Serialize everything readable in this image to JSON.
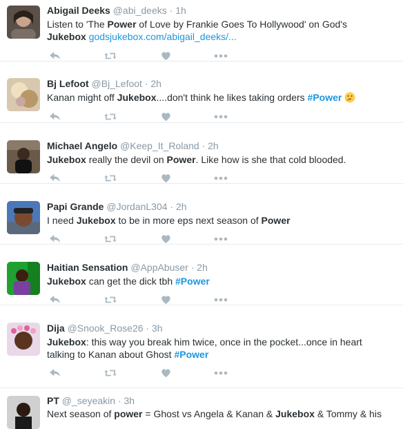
{
  "tweets": [
    {
      "name": "Abigail Deeks",
      "handle": "@abi_deeks",
      "sep": "·",
      "time": "1h",
      "text": {
        "p1": "Listen to 'The ",
        "k1": "Power",
        "p2": " of Love by Frankie Goes To Hollywood' on God's",
        "k2": "Jukebox",
        "p3": " ",
        "link": "godsjukebox.com/abigail_deeks/..."
      }
    },
    {
      "name": "Bj Lefoot",
      "handle": "@Bj_Lefoot",
      "sep": "·",
      "time": "2h",
      "text": {
        "p1": "Kanan might off ",
        "k1": "Jukebox",
        "p2": "....don't think he likes taking orders ",
        "tag": "#Power"
      }
    },
    {
      "name": "Michael Angelo",
      "handle": "@Keep_It_Roland",
      "sep": "·",
      "time": "2h",
      "text": {
        "k1": "Jukebox",
        "p1": " really the devil on ",
        "k2": "Power",
        "p2": ". Like how is she that cold blooded."
      }
    },
    {
      "name": "Papi Grande",
      "handle": "@JordanL304",
      "sep": "·",
      "time": "2h",
      "text": {
        "p1": "I need ",
        "k1": "Jukebox",
        "p2": " to be in more eps next season of ",
        "k2": "Power"
      }
    },
    {
      "name": "Haitian Sensation",
      "handle": "@AppAbuser",
      "sep": "·",
      "time": "2h",
      "text": {
        "k1": "Jukebox",
        "p1": " can get the dick tbh ",
        "tag": "#Power"
      }
    },
    {
      "name": "Dija",
      "handle": "@Snook_Rose26",
      "sep": "·",
      "time": "3h",
      "text": {
        "k1": "Jukebox",
        "p1": ": this way you break him twice, once in the pocket...once in heart",
        "p2": "talking to Kanan about Ghost ",
        "tag": "#Power"
      }
    },
    {
      "name": "PT",
      "handle": "@_seyeakin",
      "sep": "·",
      "time": "3h",
      "text": {
        "p1": "Next season of ",
        "k1": "power",
        "p2": " = Ghost vs Angela & Kanan & ",
        "k2": "Jukebox",
        "p3": " & Tommy & his"
      }
    }
  ],
  "icons": {
    "reply": "reply-icon",
    "retweet": "retweet-icon",
    "like": "heart-icon",
    "more": "more-icon",
    "emoji": "thinking-face-emoji"
  },
  "colors": {
    "text": "#292f33",
    "muted": "#8899a6",
    "link": "#1b95e0",
    "action_icon": "#aab8c2",
    "divider": "#e6ecf0"
  }
}
